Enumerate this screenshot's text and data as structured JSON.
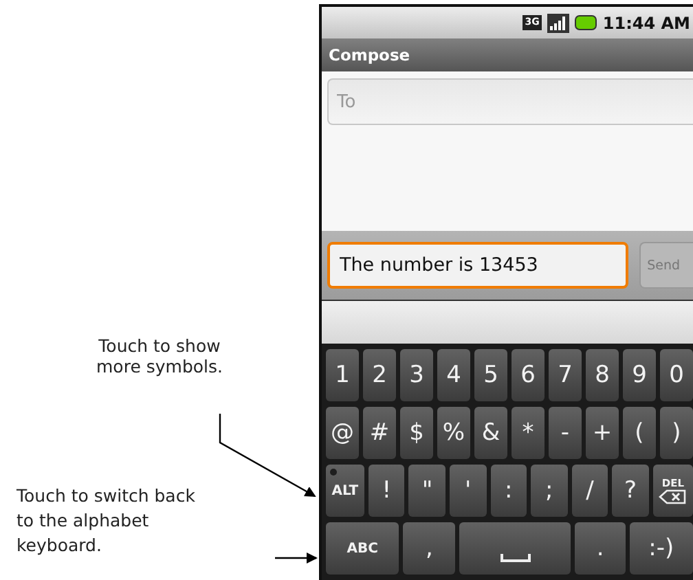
{
  "annotations": [
    {
      "text": "Touch to show more symbols."
    },
    {
      "text": "Touch to switch back to the alphabet keyboard."
    }
  ],
  "status_bar": {
    "network_type": "3G",
    "time": "11:44 AM"
  },
  "title_bar": {
    "title": "Compose"
  },
  "to_field": {
    "placeholder": "To"
  },
  "message_field": {
    "value": "The number is 13453",
    "focused": true
  },
  "send_button": {
    "label": "Send",
    "disabled": true
  },
  "keyboard": {
    "rows": [
      {
        "keys": [
          {
            "kind": "char",
            "label": "1"
          },
          {
            "kind": "char",
            "label": "2"
          },
          {
            "kind": "char",
            "label": "3"
          },
          {
            "kind": "char",
            "label": "4"
          },
          {
            "kind": "char",
            "label": "5"
          },
          {
            "kind": "char",
            "label": "6"
          },
          {
            "kind": "char",
            "label": "7"
          },
          {
            "kind": "char",
            "label": "8"
          },
          {
            "kind": "char",
            "label": "9"
          },
          {
            "kind": "char",
            "label": "0"
          }
        ]
      },
      {
        "keys": [
          {
            "kind": "char",
            "label": "@"
          },
          {
            "kind": "char",
            "label": "#"
          },
          {
            "kind": "char",
            "label": "$"
          },
          {
            "kind": "char",
            "label": "%"
          },
          {
            "kind": "char",
            "label": "&"
          },
          {
            "kind": "char",
            "label": "*"
          },
          {
            "kind": "char",
            "label": "-"
          },
          {
            "kind": "char",
            "label": "+"
          },
          {
            "kind": "char",
            "label": "("
          },
          {
            "kind": "char",
            "label": ")"
          }
        ]
      },
      {
        "keys": [
          {
            "kind": "alt",
            "label": "ALT"
          },
          {
            "kind": "char",
            "label": "!"
          },
          {
            "kind": "char",
            "label": "\""
          },
          {
            "kind": "char",
            "label": "'"
          },
          {
            "kind": "char",
            "label": ":"
          },
          {
            "kind": "char",
            "label": ";"
          },
          {
            "kind": "char",
            "label": "/"
          },
          {
            "kind": "char",
            "label": "?"
          },
          {
            "kind": "delete",
            "label": "DEL"
          }
        ]
      },
      {
        "keys": [
          {
            "kind": "abc",
            "label": "ABC"
          },
          {
            "kind": "char",
            "label": ","
          },
          {
            "kind": "space"
          },
          {
            "kind": "char",
            "label": "."
          },
          {
            "kind": "char",
            "label": ":-)"
          }
        ]
      }
    ]
  }
}
